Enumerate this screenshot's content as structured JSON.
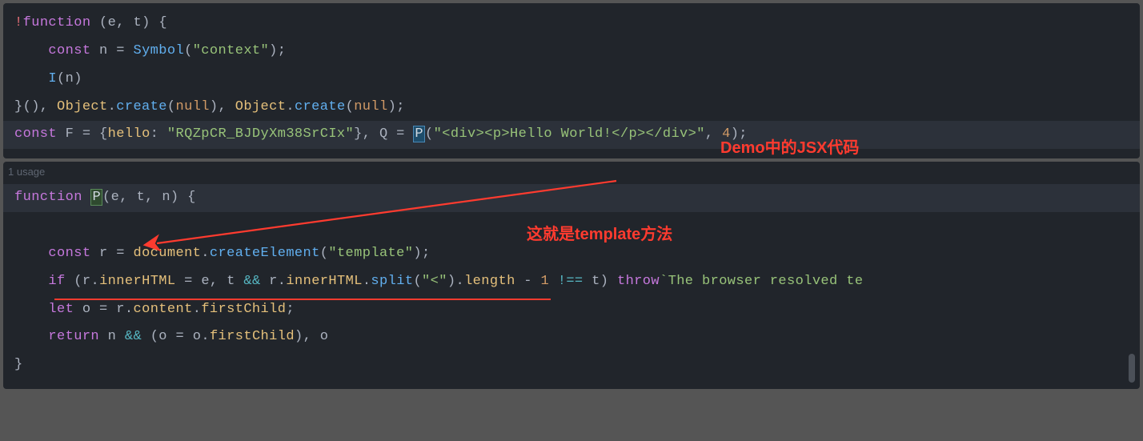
{
  "panel1": {
    "line1": {
      "bang": "!",
      "function_kw": "function",
      "sp": " ",
      "paren_open": "(",
      "param_e": "e",
      "comma1": ", ",
      "param_t": "t",
      "paren_close": ")",
      "sp2": " ",
      "brace_open": "{"
    },
    "line2": {
      "indent": "    ",
      "const_kw": "const",
      "sp": " ",
      "n": "n",
      "eq": " = ",
      "symbol_fn": "Symbol",
      "paren_open": "(",
      "str": "\"context\"",
      "paren_close": ")",
      "semi": ";"
    },
    "line3": {
      "indent": "    ",
      "I_fn": "I",
      "paren_open": "(",
      "n": "n",
      "paren_close": ")"
    },
    "line4": {
      "brace_close": "}(), ",
      "Object1": "Object",
      "dot1": ".",
      "create1": "create",
      "po1": "(",
      "null1": "null",
      "pc1": "), ",
      "Object2": "Object",
      "dot2": ".",
      "create2": "create",
      "po2": "(",
      "null2": "null",
      "pc2": ");"
    },
    "line5": {
      "const_kw": "const",
      "sp": " ",
      "F": "F",
      "eq1": " = ",
      "braceo": "{",
      "hello": "hello",
      "colon": ": ",
      "str1": "\"RQZpCR_BJDyXm38SrCIx\"",
      "bracec": "}",
      "comma": ", ",
      "Q": "Q",
      "eq2": " = ",
      "P_cursor": "P",
      "po": "(",
      "str2": "\"<div><p>Hello World!</p></div>\"",
      "comma2": ", ",
      "num": "4",
      "pc": ");"
    }
  },
  "panel2": {
    "usage": "1 usage",
    "line1": {
      "function_kw": "function",
      "sp": " ",
      "P_box": "P",
      "po": "(",
      "e": "e",
      "c1": ", ",
      "t": "t",
      "c2": ", ",
      "n": "n",
      "pc": ")",
      "sp2": " ",
      "bo": "{"
    },
    "line2": {
      "indent": "    ",
      "const_kw": "const",
      "sp": " ",
      "r": "r",
      "eq": " = ",
      "document": "document",
      "dot": ".",
      "createElement": "createElement",
      "po": "(",
      "str": "\"template\"",
      "pc": ")",
      "semi": ";"
    },
    "line3": {
      "indent": "    ",
      "if_kw": "if",
      "sp": " (",
      "r1": "r",
      "dot1": ".",
      "innerHTML1": "innerHTML",
      "eq": " = ",
      "e": "e",
      "c1": ", ",
      "t1": "t",
      "andand1": " && ",
      "r2": "r",
      "dot2": ".",
      "innerHTML2": "innerHTML",
      "dot3": ".",
      "split": "split",
      "po2": "(",
      "str": "\"<\"",
      "pc2": ")",
      "dot4": ".",
      "length": "length",
      "minus": " - ",
      "one": "1",
      "neq": " !== ",
      "t2": "t",
      "pc3": ") ",
      "throw_kw": "throw",
      "tmpl": "`The browser resolved te"
    },
    "line4": {
      "indent": "    ",
      "let_kw": "let",
      "sp": " ",
      "o": "o",
      "eq": " = ",
      "r": "r",
      "dot1": ".",
      "content": "content",
      "dot2": ".",
      "firstChild": "firstChild",
      "semi": ";"
    },
    "line5": {
      "indent": "    ",
      "return_kw": "return",
      "sp": " ",
      "n": "n",
      "andand": " && ",
      "po": "(",
      "o1": "o",
      "eq": " = ",
      "o2": "o",
      "dot": ".",
      "firstChild": "firstChild",
      "pc": "), ",
      "o3": "o"
    },
    "line6": {
      "brace_close": "}"
    }
  },
  "annotations": {
    "jsx_label": "Demo中的JSX代码",
    "template_label": "这就是template方法"
  }
}
